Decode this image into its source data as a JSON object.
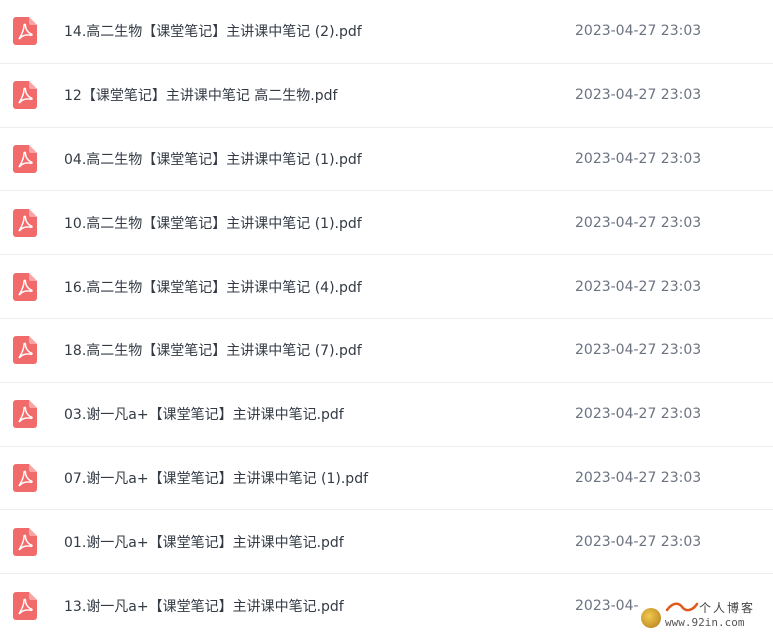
{
  "files": [
    {
      "name": "14.高二生物【课堂笔记】主讲课中笔记 (2).pdf",
      "date": "2023-04-27 23:03",
      "icon": "pdf-icon"
    },
    {
      "name": "12【课堂笔记】主讲课中笔记 高二生物.pdf",
      "date": "2023-04-27 23:03",
      "icon": "pdf-icon"
    },
    {
      "name": "04.高二生物【课堂笔记】主讲课中笔记 (1).pdf",
      "date": "2023-04-27 23:03",
      "icon": "pdf-icon"
    },
    {
      "name": "10.高二生物【课堂笔记】主讲课中笔记 (1).pdf",
      "date": "2023-04-27 23:03",
      "icon": "pdf-icon"
    },
    {
      "name": "16.高二生物【课堂笔记】主讲课中笔记 (4).pdf",
      "date": "2023-04-27 23:03",
      "icon": "pdf-icon"
    },
    {
      "name": "18.高二生物【课堂笔记】主讲课中笔记 (7).pdf",
      "date": "2023-04-27 23:03",
      "icon": "pdf-icon"
    },
    {
      "name": "03.谢一凡a+【课堂笔记】主讲课中笔记.pdf",
      "date": "2023-04-27 23:03",
      "icon": "pdf-icon"
    },
    {
      "name": "07.谢一凡a+【课堂笔记】主讲课中笔记 (1).pdf",
      "date": "2023-04-27 23:03",
      "icon": "pdf-icon"
    },
    {
      "name": "01.谢一凡a+【课堂笔记】主讲课中笔记.pdf",
      "date": "2023-04-27 23:03",
      "icon": "pdf-icon"
    },
    {
      "name": "13.谢一凡a+【课堂笔记】主讲课中笔记.pdf",
      "date": "2023-04-27",
      "icon": "pdf-icon"
    }
  ],
  "watermark": {
    "title": "个人博客",
    "url": "www.92in.com"
  },
  "colors": {
    "pdf_icon": "#f26b6b",
    "name_text": "#333a44",
    "date_text": "#6b7280",
    "divider": "#eeeeee"
  }
}
